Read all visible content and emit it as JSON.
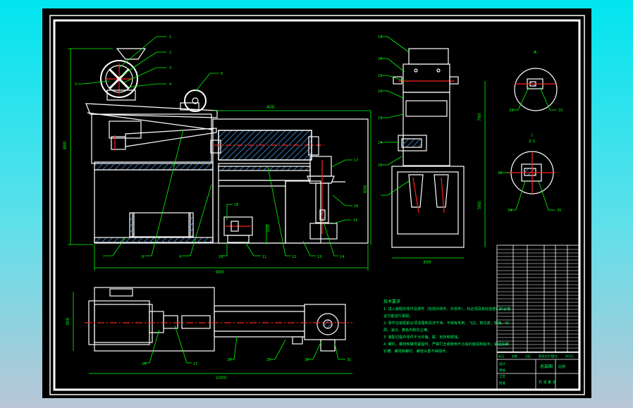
{
  "colors": {
    "background_top": "#00e5ef",
    "sheet": "#000000",
    "outline": "#ffffff",
    "centerline": "#ff2020",
    "dimension": "#00ff00",
    "hatch": "#4aa8ff",
    "tech_text": "#00ff66"
  },
  "drawing": {
    "dims": {
      "overall_height": "880",
      "top_width": "400",
      "right_height": "600",
      "bottom_width": "900",
      "small_gap": "100",
      "side_height": "760",
      "side_lower": "560",
      "side_width": "300",
      "plan_height": "300",
      "plan_width": "1000"
    },
    "section_labels": {
      "a": "A",
      "b": "I",
      "scale_b": "2:1"
    },
    "balloons_front": [
      "1",
      "2",
      "3",
      "4",
      "5",
      "6",
      "7",
      "8",
      "9",
      "10",
      "11",
      "12",
      "13",
      "14",
      "15",
      "16",
      "17",
      "18"
    ],
    "balloons_side": [
      "19",
      "20",
      "21",
      "22",
      "23",
      "24",
      "25"
    ],
    "balloons_plan": [
      "26",
      "27",
      "28",
      "29",
      "30",
      "31"
    ],
    "balloons_detail": [
      "32",
      "33",
      "34",
      "35",
      "36"
    ],
    "tech_requirements": {
      "title": "技术要求",
      "lines": [
        "1. 进入装配的零件及部件（包括外购件、外协件），均必须具有检验部门的合格",
        "证方能进行装配。",
        "2. 零件在装配前必须清理和清洗干净，不得有毛刺、飞边、氧化皮、锈蚀、切",
        "屑、油污、着色剂和灰尘等。",
        "3. 装配过程中零件不允许磕、碰、划伤和锈蚀。",
        "4. 螺钉、螺栓和螺母紧固时，严禁打击或使用不合适的旋具和扳手。紧固后螺",
        "钉槽、螺母和螺钉、螺栓头部不得损坏。"
      ]
    },
    "title_block": {
      "name": "总装图",
      "row_labels": [
        "标记",
        "处数",
        "分区",
        "更改文件号",
        "签名",
        "年月日"
      ],
      "footer": [
        "设计",
        "审核",
        "工艺",
        "批准"
      ],
      "scale_label": "比例",
      "sheet_label": "共 张 第 张"
    }
  }
}
